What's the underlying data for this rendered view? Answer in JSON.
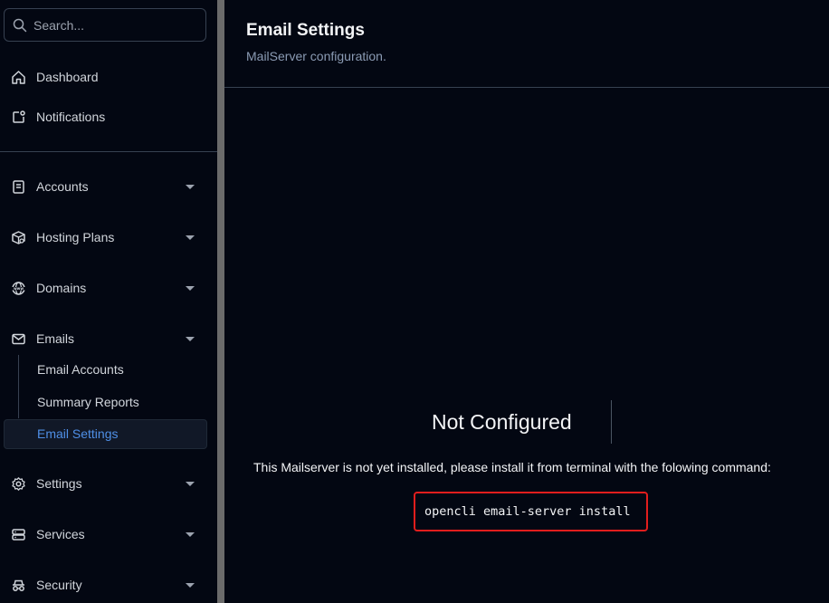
{
  "search": {
    "placeholder": "Search..."
  },
  "sidebar": {
    "items": [
      {
        "label": "Dashboard"
      },
      {
        "label": "Notifications"
      },
      {
        "label": "Accounts"
      },
      {
        "label": "Hosting Plans"
      },
      {
        "label": "Domains"
      },
      {
        "label": "Emails"
      },
      {
        "label": "Settings"
      },
      {
        "label": "Services"
      },
      {
        "label": "Security"
      }
    ],
    "email_sub": [
      {
        "label": "Email Accounts"
      },
      {
        "label": "Summary Reports"
      },
      {
        "label": "Email Settings"
      }
    ]
  },
  "header": {
    "title": "Email Settings",
    "subtitle": "MailServer configuration."
  },
  "content": {
    "status": "Not Configured",
    "message": "This Mailserver is not yet installed, please install it from terminal with the folowing command:",
    "command": "opencli email-server install"
  },
  "colors": {
    "accent": "#4f8fe6",
    "highlight_border": "#e11d1d",
    "background": "#030712"
  }
}
